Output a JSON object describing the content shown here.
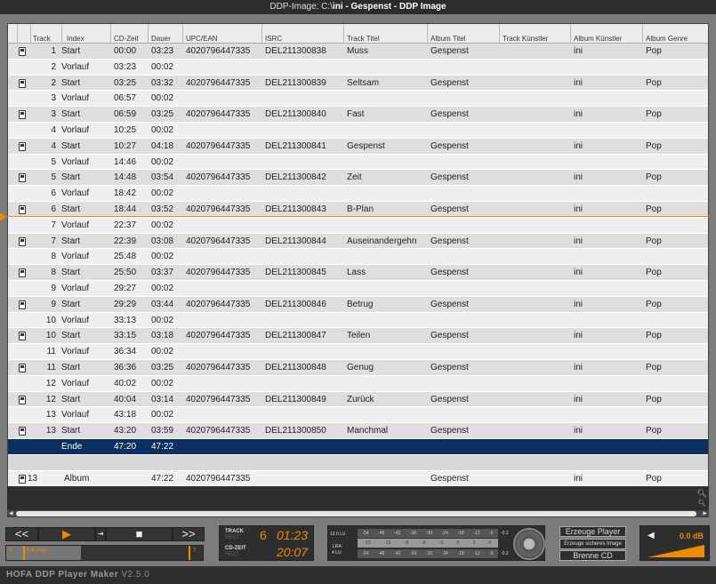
{
  "window_title_prefix": "DDP-Image: C:\\",
  "window_title_bold": "ini - Gespenst - DDP Image",
  "columns": [
    "Track",
    "Index",
    "CD-Zeit",
    "Dauer",
    "UPC/EAN",
    "ISRC",
    "Track Titel",
    "Album Titel",
    "Track Künstler",
    "Album Künstler",
    "Album Genre"
  ],
  "rows": [
    {
      "type": "start",
      "track": "1",
      "index": "Start",
      "cdzeit": "00:00",
      "dauer": "03:23",
      "upc": "4020796447335",
      "isrc": "DEL211300838",
      "titel": "Muss",
      "album": "Gespenst",
      "tk": "",
      "ak": "ini",
      "genre": "Pop"
    },
    {
      "type": "vor",
      "track": "2",
      "index": "Vorlauf",
      "cdzeit": "03:23",
      "dauer": "00:02"
    },
    {
      "type": "start",
      "track": "2",
      "index": "Start",
      "cdzeit": "03:25",
      "dauer": "03:32",
      "upc": "4020796447335",
      "isrc": "DEL211300839",
      "titel": "Seltsam",
      "album": "Gespenst",
      "tk": "",
      "ak": "ini",
      "genre": "Pop"
    },
    {
      "type": "vor",
      "track": "3",
      "index": "Vorlauf",
      "cdzeit": "06:57",
      "dauer": "00:02"
    },
    {
      "type": "start",
      "track": "3",
      "index": "Start",
      "cdzeit": "06:59",
      "dauer": "03:25",
      "upc": "4020796447335",
      "isrc": "DEL211300840",
      "titel": "Fast",
      "album": "Gespenst",
      "tk": "",
      "ak": "ini",
      "genre": "Pop"
    },
    {
      "type": "vor",
      "track": "4",
      "index": "Vorlauf",
      "cdzeit": "10:25",
      "dauer": "00:02"
    },
    {
      "type": "start",
      "track": "4",
      "index": "Start",
      "cdzeit": "10:27",
      "dauer": "04:18",
      "upc": "4020796447335",
      "isrc": "DEL211300841",
      "titel": "Gespenst",
      "album": "Gespenst",
      "tk": "",
      "ak": "ini",
      "genre": "Pop"
    },
    {
      "type": "vor",
      "track": "5",
      "index": "Vorlauf",
      "cdzeit": "14:46",
      "dauer": "00:02"
    },
    {
      "type": "start",
      "track": "5",
      "index": "Start",
      "cdzeit": "14:48",
      "dauer": "03:54",
      "upc": "4020796447335",
      "isrc": "DEL211300842",
      "titel": "Zeit",
      "album": "Gespenst",
      "tk": "",
      "ak": "ini",
      "genre": "Pop"
    },
    {
      "type": "vor",
      "track": "6",
      "index": "Vorlauf",
      "cdzeit": "18:42",
      "dauer": "00:02"
    },
    {
      "type": "start",
      "track": "6",
      "index": "Start",
      "cdzeit": "18:44",
      "dauer": "03:52",
      "upc": "4020796447335",
      "isrc": "DEL211300843",
      "titel": "B-Plan",
      "album": "Gespenst",
      "tk": "",
      "ak": "ini",
      "genre": "Pop"
    },
    {
      "type": "vor",
      "track": "7",
      "index": "Vorlauf",
      "cdzeit": "22:37",
      "dauer": "00:02"
    },
    {
      "type": "start",
      "track": "7",
      "index": "Start",
      "cdzeit": "22:39",
      "dauer": "03:08",
      "upc": "4020796447335",
      "isrc": "DEL211300844",
      "titel": "Auseinandergehn",
      "album": "Gespenst",
      "tk": "",
      "ak": "ini",
      "genre": "Pop"
    },
    {
      "type": "vor",
      "track": "8",
      "index": "Vorlauf",
      "cdzeit": "25:48",
      "dauer": "00:02"
    },
    {
      "type": "start",
      "track": "8",
      "index": "Start",
      "cdzeit": "25:50",
      "dauer": "03:37",
      "upc": "4020796447335",
      "isrc": "DEL211300845",
      "titel": "Lass",
      "album": "Gespenst",
      "tk": "",
      "ak": "ini",
      "genre": "Pop"
    },
    {
      "type": "vor",
      "track": "9",
      "index": "Vorlauf",
      "cdzeit": "29:27",
      "dauer": "00:02"
    },
    {
      "type": "start",
      "track": "9",
      "index": "Start",
      "cdzeit": "29:29",
      "dauer": "03:44",
      "upc": "4020796447335",
      "isrc": "DEL211300846",
      "titel": "Betrug",
      "album": "Gespenst",
      "tk": "",
      "ak": "ini",
      "genre": "Pop"
    },
    {
      "type": "vor",
      "track": "10",
      "index": "Vorlauf",
      "cdzeit": "33:13",
      "dauer": "00:02"
    },
    {
      "type": "start",
      "track": "10",
      "index": "Start",
      "cdzeit": "33:15",
      "dauer": "03:18",
      "upc": "4020796447335",
      "isrc": "DEL211300847",
      "titel": "Teilen",
      "album": "Gespenst",
      "tk": "",
      "ak": "ini",
      "genre": "Pop"
    },
    {
      "type": "vor",
      "track": "11",
      "index": "Vorlauf",
      "cdzeit": "36:34",
      "dauer": "00:02"
    },
    {
      "type": "start",
      "track": "11",
      "index": "Start",
      "cdzeit": "36:36",
      "dauer": "03:25",
      "upc": "4020796447335",
      "isrc": "DEL211300848",
      "titel": "Genug",
      "album": "Gespenst",
      "tk": "",
      "ak": "ini",
      "genre": "Pop"
    },
    {
      "type": "vor",
      "track": "12",
      "index": "Vorlauf",
      "cdzeit": "40:02",
      "dauer": "00:02"
    },
    {
      "type": "start",
      "track": "12",
      "index": "Start",
      "cdzeit": "40:04",
      "dauer": "03:14",
      "upc": "4020796447335",
      "isrc": "DEL211300849",
      "titel": "Zurück",
      "album": "Gespenst",
      "tk": "",
      "ak": "ini",
      "genre": "Pop"
    },
    {
      "type": "vor",
      "track": "13",
      "index": "Vorlauf",
      "cdzeit": "43:18",
      "dauer": "00:02"
    },
    {
      "type": "start",
      "track": "13",
      "index": "Start",
      "cdzeit": "43:20",
      "dauer": "03:59",
      "upc": "4020796447335",
      "isrc": "DEL211300850",
      "titel": "Manchmal",
      "album": "Gespenst",
      "tk": "",
      "ak": "ini",
      "genre": "Pop"
    },
    {
      "type": "ende",
      "track": "",
      "index": "Ende",
      "cdzeit": "47:20",
      "dauer": "47:22"
    },
    {
      "type": "empty"
    },
    {
      "type": "album",
      "track": "13",
      "index": "Album",
      "cdzeit": "",
      "dauer": "47:22",
      "upc": "4020796447335",
      "isrc": "",
      "titel": "",
      "album": "Gespenst",
      "tk": "",
      "ak": "ini",
      "genre": "Pop"
    }
  ],
  "transport": {
    "rewind": "<<",
    "play": "▶",
    "stop": "■",
    "forward": ">>"
  },
  "progress": {
    "start_marker": "5",
    "current": "6 B-Plan",
    "end_marker": "7",
    "fraction": 0.38
  },
  "time": {
    "track_label": "TRACK",
    "track_sub": "REST",
    "track_no": "6",
    "track_time": "01:23",
    "cd_label": "CD-ZEIT",
    "cd_sub": "REST",
    "cd_time": "20:07"
  },
  "meter": {
    "lu": "12.0 LU",
    "lra": "LRA:",
    "lra_val": "4 LU",
    "scale_top": [
      "-54",
      "-48",
      "-42",
      "-36",
      "-30",
      "-24",
      "-18",
      "-12",
      "-6"
    ],
    "scale_mid": [
      "-15",
      "-12",
      "-9",
      "-6",
      "-3",
      "0",
      "3",
      "6"
    ],
    "peak_top": "-0.2",
    "peak_bottom": "-0.2"
  },
  "actions": {
    "player": "Erzeuge Player",
    "secure": "Erzeuge sicheres Image",
    "burn": "Brenne CD"
  },
  "volume": {
    "value": "0.0 dB"
  },
  "footer": {
    "app": "HOFA DDP Player Maker",
    "version": "V2.5.0"
  },
  "colors": {
    "accent": "#f08a00",
    "selection": "#0b2f5f"
  }
}
